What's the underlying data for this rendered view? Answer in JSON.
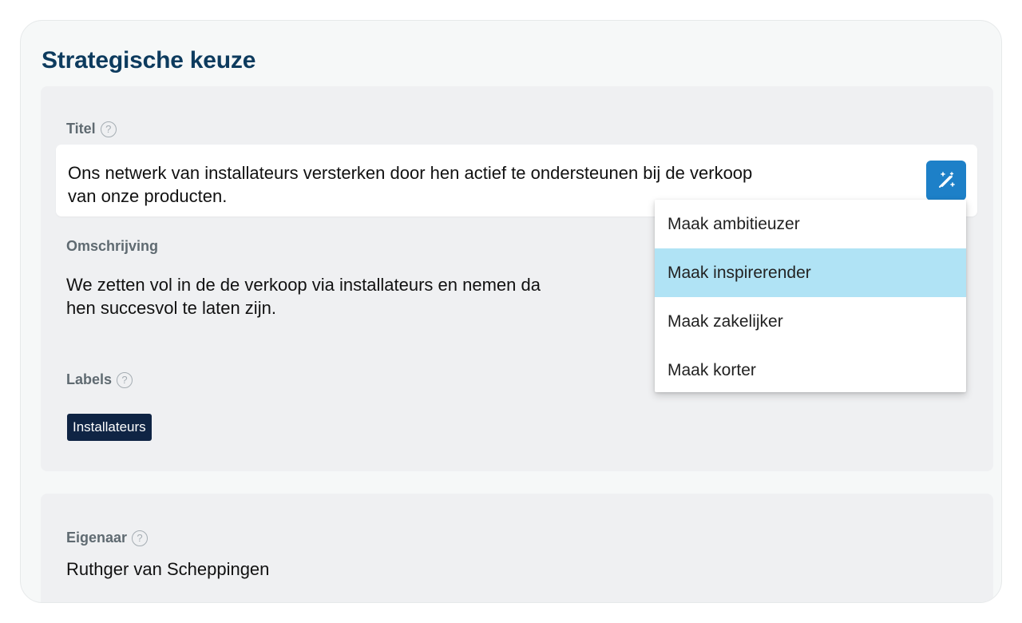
{
  "card": {
    "title": "Strategische keuze"
  },
  "fields": {
    "title": {
      "label": "Titel",
      "value": "Ons netwerk van installateurs versterken door hen actief te ondersteunen bij de verkoop\nvan onze producten."
    },
    "description": {
      "label": "Omschrijving",
      "value": "We zetten vol in de de verkoop via installateurs en nemen da\nhen succesvol te laten zijn."
    },
    "labels": {
      "label": "Labels",
      "tags": [
        "Installateurs"
      ]
    },
    "owner": {
      "label": "Eigenaar",
      "value": "Ruthger van Scheppingen"
    }
  },
  "help_icon_glyph": "?",
  "ai_menu": {
    "items": [
      "Maak ambitieuzer",
      "Maak inspirerender",
      "Maak zakelijker",
      "Maak korter"
    ],
    "highlighted_index": 1
  },
  "colors": {
    "title": "#0d3b5e",
    "accent_button": "#1d80c8",
    "tag_bg": "#0f2444",
    "menu_highlight": "#b0e3f5"
  },
  "icons": {
    "help": "question-circle-icon",
    "ai": "magic-wand-icon"
  }
}
